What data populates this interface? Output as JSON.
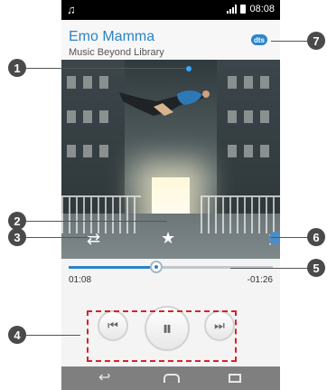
{
  "status": {
    "time": "08:08"
  },
  "header": {
    "title": "Emo Mamma",
    "subtitle": "Music Beyond Library",
    "badge": "dts"
  },
  "controls": {
    "shuffle_icon": "shuffle-icon",
    "favorite_icon": "star-icon",
    "menu_icon": "more-options-icon",
    "prev_icon": "previous-icon",
    "play_icon": "pause-icon",
    "next_icon": "next-icon"
  },
  "progress": {
    "elapsed": "01:08",
    "remaining": "-01:26",
    "percent": 43
  },
  "callouts": [
    "1",
    "2",
    "3",
    "4",
    "5",
    "6",
    "7"
  ],
  "navigation": {
    "back_icon": "back-icon",
    "home_icon": "home-icon",
    "recent_icon": "recent-apps-icon"
  },
  "colors": {
    "accent": "#2b83c5",
    "callout": "#4a4a4a",
    "highlight_box": "#d9202b"
  }
}
